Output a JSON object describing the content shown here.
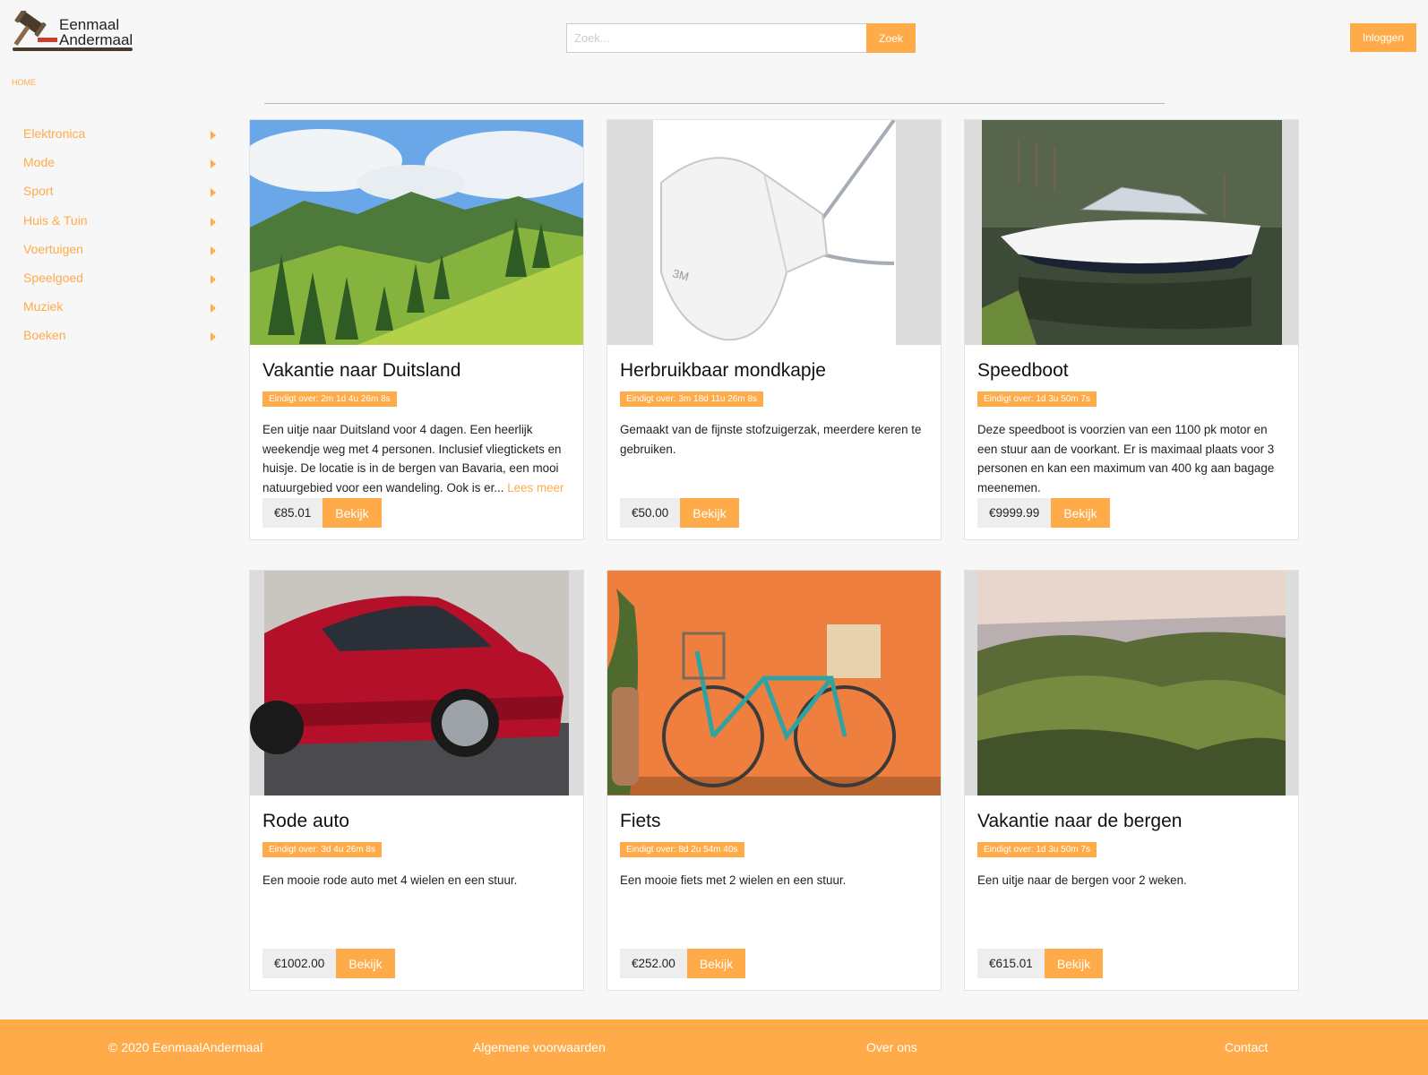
{
  "brand": {
    "line1": "Eenmaal",
    "line2": "Andermaal"
  },
  "search": {
    "placeholder": "Zoek...",
    "button": "Zoek"
  },
  "header": {
    "login": "Inloggen"
  },
  "breadcrumb": "HOME",
  "categories": [
    "Elektronica",
    "Mode",
    "Sport",
    "Huis & Tuin",
    "Voertuigen",
    "Speelgoed",
    "Muziek",
    "Boeken"
  ],
  "products": [
    {
      "title": "Vakantie naar Duitsland",
      "timer": "Eindigt over: 2m 1d 4u 26m 8s",
      "desc": "Een uitje naar Duitsland voor 4 dagen. Een heerlijk weekendje weg met 4 personen. Inclusief vliegtickets en huisje. De locatie is in de bergen van Bavaria, een mooi natuurgebied voor een wandeling. Ook is er...",
      "more": "Lees meer",
      "price": "€85.01",
      "button": "Bekijk"
    },
    {
      "title": "Herbruikbaar mondkapje",
      "timer": "Eindigt over: 3m 18d 11u 26m 8s",
      "desc": "Gemaakt van de fijnste stofzuigerzak, meerdere keren te gebruiken.",
      "more": "",
      "price": "€50.00",
      "button": "Bekijk"
    },
    {
      "title": "Speedboot",
      "timer": "Eindigt over: 1d 3u 50m 7s",
      "desc": "Deze speedboot is voorzien van een 1100 pk motor en een stuur aan de voorkant. Er is maximaal plaats voor 3 personen en kan een maximum van 400 kg aan bagage meenemen.",
      "more": "",
      "price": "€9999.99",
      "button": "Bekijk"
    },
    {
      "title": "Rode auto",
      "timer": "Eindigt over: 3d 4u 26m 8s",
      "desc": "Een mooie rode auto met 4 wielen en een stuur.",
      "more": "",
      "price": "€1002.00",
      "button": "Bekijk"
    },
    {
      "title": "Fiets",
      "timer": "Eindigt over: 8d 2u 54m 40s",
      "desc": "Een mooie fiets met 2 wielen en een stuur.",
      "more": "",
      "price": "€252.00",
      "button": "Bekijk"
    },
    {
      "title": "Vakantie naar de bergen",
      "timer": "Eindigt over: 1d 3u 50m 7s",
      "desc": "Een uitje naar de bergen voor 2 weken.",
      "more": "",
      "price": "€615.01",
      "button": "Bekijk"
    }
  ],
  "footer": {
    "copyright": "© 2020 EenmaalAndermaal",
    "terms": "Algemene voorwaarden",
    "about": "Over ons",
    "contact": "Contact"
  },
  "colors": {
    "accent": "#ffab4a",
    "background": "#f7f7f7"
  }
}
